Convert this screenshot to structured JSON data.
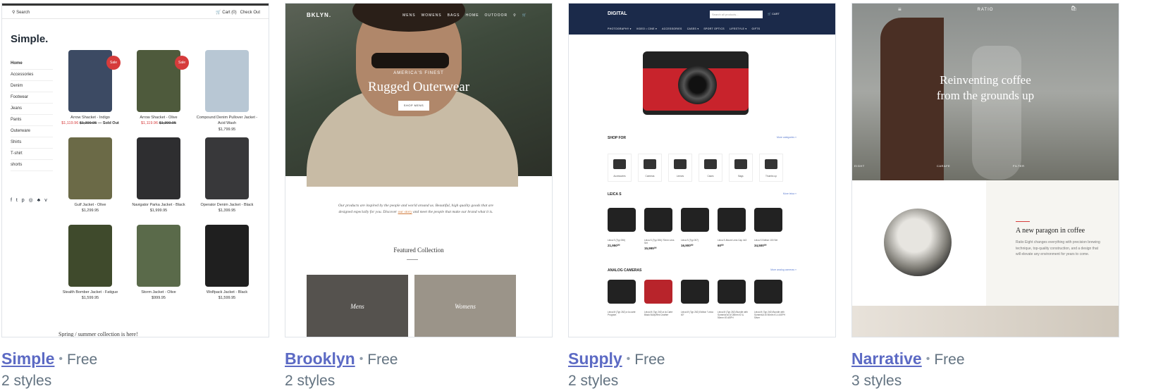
{
  "themes": [
    {
      "name": "Simple",
      "price": "Free",
      "styles": "2 styles"
    },
    {
      "name": "Brooklyn",
      "price": "Free",
      "styles": "2 styles"
    },
    {
      "name": "Supply",
      "price": "Free",
      "styles": "2 styles"
    },
    {
      "name": "Narrative",
      "price": "Free",
      "styles": "3 styles"
    }
  ],
  "simple": {
    "search": "Search",
    "cart": "Cart (0)",
    "checkout": "Check Out",
    "logo": "Simple.",
    "nav": [
      "Home",
      "Accessories",
      "Denim",
      "Footwear",
      "Jeans",
      "Pants",
      "Outerware",
      "Shirts",
      "T-shirt",
      "shorts"
    ],
    "sale_badge": "Sale",
    "products": [
      {
        "name": "Arrow Shacket - Indigo",
        "price": "$1,119.96",
        "old": "$1,399.95",
        "extra": "— Sold Out",
        "color": "#3c4a63",
        "sale": true
      },
      {
        "name": "Arrow Shacket - Olive",
        "price": "$1,119.96",
        "old": "$1,399.95",
        "extra": "",
        "color": "#4e5a3c",
        "sale": true
      },
      {
        "name": "Compound Denim Pullover Jacket - Acid Wash",
        "price": "$1,799.95",
        "old": "",
        "extra": "",
        "color": "#b8c7d4",
        "sale": false
      },
      {
        "name": "Gulf Jacket - Olive",
        "price": "$1,299.95",
        "old": "",
        "extra": "",
        "color": "#6b6a47",
        "sale": false
      },
      {
        "name": "Navigator Parka Jacket - Black",
        "price": "$1,999.95",
        "old": "",
        "extra": "",
        "color": "#2e2e30",
        "sale": false
      },
      {
        "name": "Operator Denim Jacket - Black",
        "price": "$1,399.95",
        "old": "",
        "extra": "",
        "color": "#38383a",
        "sale": false
      },
      {
        "name": "Stealth Bomber Jacket - Fatigue",
        "price": "$1,599.95",
        "old": "",
        "extra": "",
        "color": "#3f4a2c",
        "sale": false
      },
      {
        "name": "Storm Jacket - Olive",
        "price": "$999.95",
        "old": "",
        "extra": "",
        "color": "#5a6a4a",
        "sale": false
      },
      {
        "name": "Wolfpack Jacket - Black",
        "price": "$1,599.95",
        "old": "",
        "extra": "",
        "color": "#1f1f1f",
        "sale": false
      }
    ],
    "footer": "Spring / summer collection is here!"
  },
  "brooklyn": {
    "logo": "BKLYN.",
    "nav": [
      "MENS",
      "WOMENS",
      "BAGS",
      "HOME",
      "OUTDOOR"
    ],
    "kicker": "AMERICA'S FINEST",
    "title": "Rugged Outerwear",
    "button": "SHOP MENS",
    "copy_1": "Our products are inspired by the people and world around us. Beautiful, high quality goods that are designed especially for you. Discover ",
    "copy_link": "our story",
    "copy_2": " and meet the people that make our brand what it is.",
    "featured": "Featured Collection",
    "tiles": [
      {
        "label": "Mens",
        "color": "#55524e"
      },
      {
        "label": "Womens",
        "color": "#9b9489"
      }
    ]
  },
  "supply": {
    "logo": "DIGITAL",
    "search": "Search all products...",
    "cart": "CART",
    "nav": [
      "PHOTOGRAPHY ▾",
      "VIDEO • CINE ▾",
      "ACCESSORIES",
      "CASES ▾",
      "SPORT OPTICS",
      "LIFESTYLE ▾",
      "GIFTS"
    ],
    "shop_for": "SHOP FOR",
    "shop_more": "More categories »",
    "categories": [
      "Accessories",
      "Cameras",
      "Lenses",
      "Cases",
      "Bags",
      "Thumbs up"
    ],
    "leica_title": "LEICA S",
    "leica_more": "More leica »",
    "leica": [
      {
        "name": "Leica S (Typ 006)",
        "price": "21,950⁰⁰"
      },
      {
        "name": "Leica S (Typ 006) 70mm Lens Set",
        "price": "15,995⁰⁰"
      },
      {
        "name": "Leica S (Typ 007)",
        "price": "16,900⁰⁰"
      },
      {
        "name": "Leica S-Mount Lens Cap 4x3",
        "price": "60⁰⁰"
      },
      {
        "name": "Leica S Edition 100 Set",
        "price": "34,500⁰⁰"
      }
    ],
    "analog_title": "ANALOG CAMERAS",
    "analog_more": "More analog cameras »",
    "analog": [
      {
        "name": "Leica M (Typ 262) à la carte Program"
      },
      {
        "name": "Leica M (Typ 240) à la Carte Black Body/Red Leather"
      },
      {
        "name": "Leica M (Typ 262) Edition \"Leica 60\""
      },
      {
        "name": "Leica M (Typ 262) Bundle with Summicron-M 28mm f/2 & 50mm f/2 ASPH"
      },
      {
        "name": "Leica M (Typ 240) Bundle with Summilux-M 50mm f/1.4 ASPH Silver"
      }
    ]
  },
  "narrative": {
    "logo": "RATIO",
    "title_1": "Reinventing coffee",
    "title_2": "from the grounds up",
    "labels": [
      "EIGHT",
      "CARAFE",
      "FILTER"
    ],
    "heading": "A new paragon in coffee",
    "body": "Ratio Eight changes everything with precision brewing technique, top-quality construction, and a design that will elevate any environment for years to come."
  },
  "colors": {
    "link": "#5c6ac4",
    "muted": "#637381",
    "sale": "#d63b3b",
    "supply_header": "#1b2a4a"
  }
}
